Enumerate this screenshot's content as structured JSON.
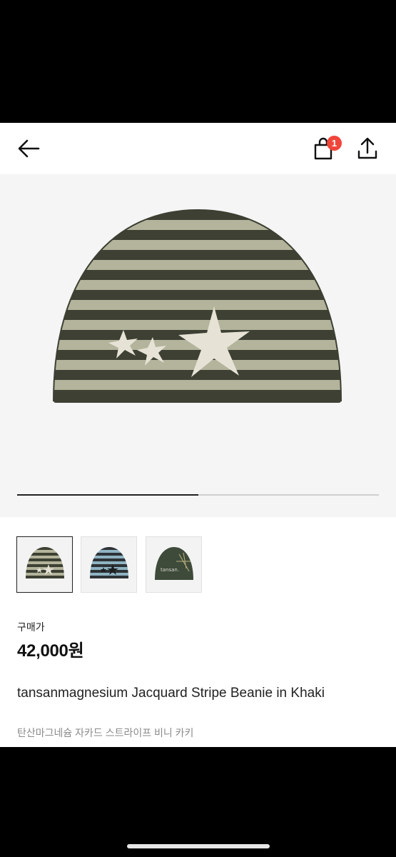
{
  "header": {
    "back_icon": "arrow-left-icon",
    "bag_icon": "shopping-bag-icon",
    "bag_badge_count": "1",
    "share_icon": "share-upload-icon"
  },
  "gallery": {
    "current_image_progress": 0.5,
    "colors": {
      "stripe_dark": "#3d4033",
      "stripe_light": "#b3b49b",
      "star": "#e6e2d6"
    }
  },
  "thumbnails": [
    {
      "selected": true
    },
    {
      "selected": false
    },
    {
      "selected": false
    }
  ],
  "product": {
    "price_label": "구매가",
    "price": "42,000원",
    "title_en": "tansanmagnesium Jacquard Stripe Beanie in Khaki",
    "title_ko": "탄산마그네슘 자카드 스트라이프 비니 카키",
    "thumb3_brand_text": "tansan."
  },
  "colors": {
    "badge": "#f0453a",
    "text_primary": "#111111",
    "text_secondary": "#8a8a8a"
  }
}
